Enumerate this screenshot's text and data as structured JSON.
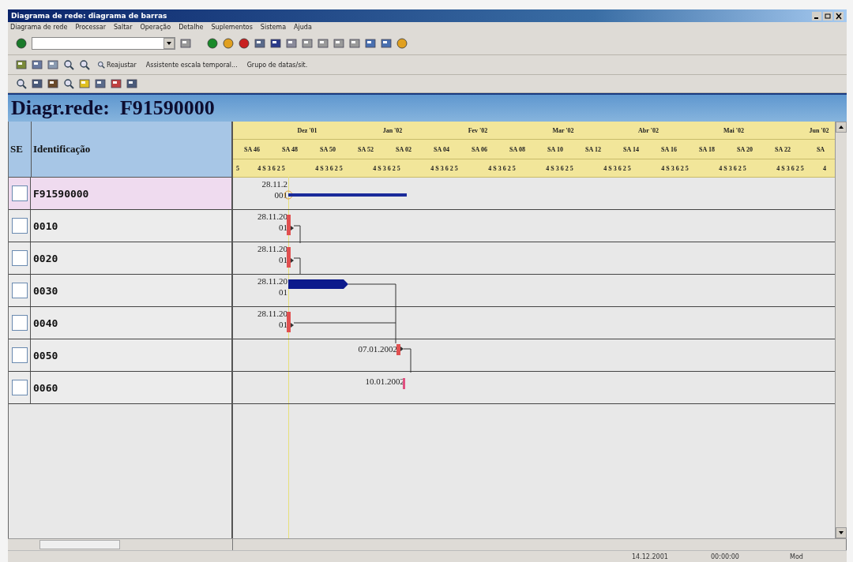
{
  "window": {
    "title": "Diagrama de rede: diagrama de barras"
  },
  "menu": [
    "Diagrama de rede",
    "Processar",
    "Saltar",
    "Operação",
    "Detalhe",
    "Suplementos",
    "Sistema",
    "Ajuda"
  ],
  "toolbar2": {
    "buttons": [
      "Reajustar",
      "Assistente escala temporal...",
      "Grupo de datas/sit."
    ]
  },
  "diagram_title": "Diagr.rede:  F91590000",
  "table": {
    "columns": [
      "SE",
      "Identificação"
    ],
    "months": [
      "Dez '01",
      "Jan '02",
      "Fev '02",
      "Mar '02",
      "Abr '02",
      "Mai '02",
      "Jun '02"
    ],
    "weeks": [
      "SA 46",
      "SA 48",
      "SA 50",
      "SA 52",
      "SA 02",
      "SA 04",
      "SA 06",
      "SA 08",
      "SA 10",
      "SA 12",
      "SA 14",
      "SA 16",
      "SA 18",
      "SA 20",
      "SA 22",
      "SA"
    ],
    "days": [
      "5",
      "4 S 3 6 2 5",
      "4 S 3 6 2 5",
      "4 S 3 6 2 5",
      "4 S 3 6 2 5",
      "4 S 3 6 2 5",
      "4 S 3 6 2 5",
      "4 S 3 6 2 5",
      "4 S 3 6 2 5",
      "4 S 3 6 2 5",
      "4 S 3 6 2 5",
      "4"
    ],
    "rows": [
      {
        "id": "F91590000",
        "selected": true,
        "checked": false,
        "kind": "summary",
        "date": "28.11.2",
        "date_2": "001"
      },
      {
        "id": "0010",
        "selected": false,
        "checked": false,
        "kind": "milestone",
        "date": "28.11.20",
        "date_2": "01"
      },
      {
        "id": "0020",
        "selected": false,
        "checked": false,
        "kind": "milestone",
        "date": "28.11.20",
        "date_2": "01"
      },
      {
        "id": "0030",
        "selected": false,
        "checked": false,
        "kind": "activity",
        "date": "28.11.20",
        "date_2": "01"
      },
      {
        "id": "0040",
        "selected": false,
        "checked": false,
        "kind": "milestone",
        "date": "28.11.20",
        "date_2": "01"
      },
      {
        "id": "0050",
        "selected": false,
        "checked": false,
        "kind": "milestone",
        "date": "07.01.2002"
      },
      {
        "id": "0060",
        "selected": false,
        "checked": false,
        "kind": "end",
        "date": "10.01.2002"
      }
    ]
  },
  "status_bar": [
    "14.12.2001",
    "00:00:00",
    "Mod"
  ]
}
